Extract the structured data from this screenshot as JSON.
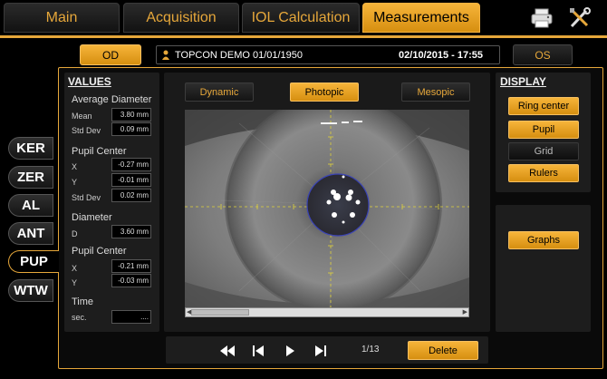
{
  "tabs": [
    {
      "label": "Main",
      "active": false
    },
    {
      "label": "Acquisition",
      "active": false
    },
    {
      "label": "IOL Calculation",
      "active": false
    },
    {
      "label": "Measurements",
      "active": true
    }
  ],
  "toolbar": {
    "print_icon": "printer-icon",
    "tools_icon": "tools-icon"
  },
  "eye": {
    "od_label": "OD",
    "os_label": "OS",
    "selected": "OD"
  },
  "patient": {
    "name": "TOPCON DEMO 01/01/1950",
    "datetime": "02/10/2015 - 17:55"
  },
  "side_tabs": [
    "KER",
    "ZER",
    "AL",
    "ANT",
    "PUP",
    "WTW"
  ],
  "side_active": "PUP",
  "values": {
    "heading": "VALUES",
    "average_diameter": {
      "title": "Average Diameter",
      "mean_label": "Mean",
      "mean": "3.80 mm",
      "std_label": "Std Dev",
      "std": "0.09 mm"
    },
    "pupil_center": {
      "title": "Pupil Center",
      "x_label": "X",
      "x": "-0.27 mm",
      "y_label": "Y",
      "y": "-0.01 mm",
      "std_label": "Std Dev",
      "std": "0.02 mm"
    },
    "diameter": {
      "title": "Diameter",
      "d_label": "D",
      "d": "3.60 mm"
    },
    "pupil_center2": {
      "title": "Pupil Center",
      "x_label": "X",
      "x": "-0.21 mm",
      "y_label": "Y",
      "y": "-0.03 mm"
    },
    "time": {
      "title": "Time",
      "sec_label": "sec.",
      "sec": "...."
    }
  },
  "modes": {
    "dynamic": "Dynamic",
    "photopic": "Photopic",
    "mesopic": "Mesopic",
    "selected": "Photopic"
  },
  "navigation": {
    "counter": "1/13",
    "delete_label": "Delete"
  },
  "display": {
    "heading": "DISPLAY",
    "ring_center": "Ring center",
    "pupil": "Pupil",
    "grid": "Grid",
    "rulers": "Rulers",
    "graphs": "Graphs"
  },
  "colors": {
    "accent": "#e6a73a",
    "crosshair": "#e0d23a",
    "pupil_ring": "#3a43b5"
  }
}
